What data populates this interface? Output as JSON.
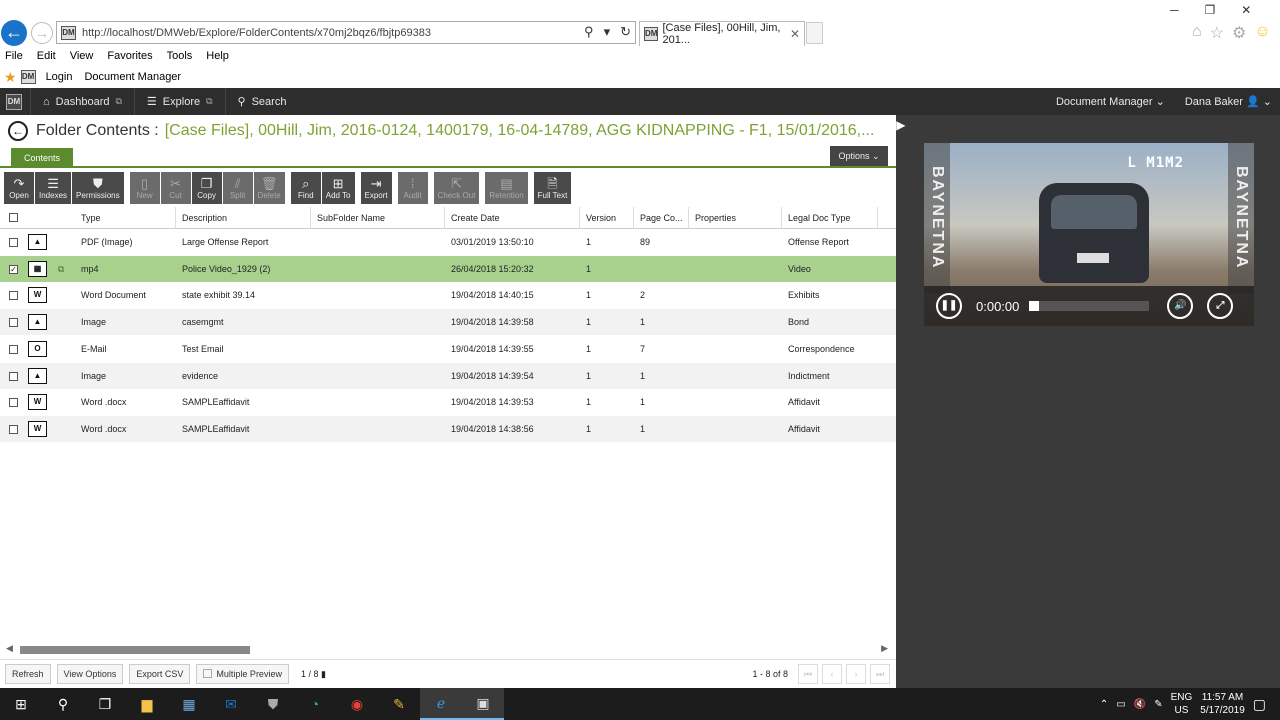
{
  "browser": {
    "url": "http://localhost/DMWeb/Explore/FolderContents/x70mj2bqz6/fbjtp69383",
    "tab_title": "[Case Files], 00Hill, Jim, 201...",
    "favicon_text": "DM",
    "menu": [
      "File",
      "Edit",
      "View",
      "Favorites",
      "Tools",
      "Help"
    ],
    "favorites": {
      "login": "Login",
      "document_manager": "Document Manager"
    }
  },
  "app_nav": {
    "logo": "DM",
    "dashboard": "Dashboard",
    "explore": "Explore",
    "search": "Search",
    "module": "Document Manager",
    "user": "Dana Baker"
  },
  "folder": {
    "label": "Folder Contents :",
    "path": "[Case Files], 00Hill, Jim, 2016-0124, 1400179, 16-04-14789, AGG KIDNAPPING - F1, 15/01/2016,...",
    "tab": "Contents",
    "options": "Options"
  },
  "toolbar": {
    "open": "Open",
    "indexes": "Indexes",
    "permissions": "Permissions",
    "new": "New",
    "cut": "Cut",
    "copy": "Copy",
    "split": "Split",
    "delete": "Delete",
    "find": "Find",
    "add_to": "Add To",
    "export": "Export",
    "audit": "Audit",
    "check_out": "Check Out",
    "retention": "Retention",
    "full_text": "Full Text"
  },
  "columns": [
    "Type",
    "Description",
    "SubFolder Name",
    "Create Date",
    "Version",
    "Page Co...",
    "Properties",
    "Legal Doc Type"
  ],
  "rows": [
    {
      "icon": "image",
      "type": "PDF (Image)",
      "description": "Large Offense Report",
      "subfolder": "",
      "date": "03/01/2019 13:50:10",
      "version": "1",
      "pages": "89",
      "properties": "",
      "legal": "Offense Report",
      "checked": ""
    },
    {
      "icon": "video",
      "type": "mp4",
      "description": "Police Video_1929 (2)",
      "subfolder": "",
      "date": "26/04/2018 15:20:32",
      "version": "1",
      "pages": "",
      "properties": "",
      "legal": "Video",
      "checked": "✓"
    },
    {
      "icon": "word",
      "type": "Word Document",
      "description": "state exhibit 39.14",
      "subfolder": "",
      "date": "19/04/2018 14:40:15",
      "version": "1",
      "pages": "2",
      "properties": "",
      "legal": "Exhibits",
      "checked": ""
    },
    {
      "icon": "image",
      "type": "Image",
      "description": "casemgmt",
      "subfolder": "",
      "date": "19/04/2018 14:39:58",
      "version": "1",
      "pages": "1",
      "properties": "",
      "legal": "Bond",
      "checked": ""
    },
    {
      "icon": "outlook",
      "type": "E-Mail",
      "description": "Test Email",
      "subfolder": "",
      "date": "19/04/2018 14:39:55",
      "version": "1",
      "pages": "7",
      "properties": "",
      "legal": "Correspondence",
      "checked": ""
    },
    {
      "icon": "image",
      "type": "Image",
      "description": "evidence",
      "subfolder": "",
      "date": "19/04/2018 14:39:54",
      "version": "1",
      "pages": "1",
      "properties": "",
      "legal": "Indictment",
      "checked": ""
    },
    {
      "icon": "word",
      "type": "Word .docx",
      "description": "SAMPLEaffidavit",
      "subfolder": "",
      "date": "19/04/2018 14:39:53",
      "version": "1",
      "pages": "1",
      "properties": "",
      "legal": "Affidavit",
      "checked": ""
    },
    {
      "icon": "word",
      "type": "Word .docx",
      "description": "SAMPLEaffidavit",
      "subfolder": "",
      "date": "19/04/2018 14:38:56",
      "version": "1",
      "pages": "1",
      "properties": "",
      "legal": "Affidavit",
      "checked": ""
    }
  ],
  "footer": {
    "refresh": "Refresh",
    "view_options": "View Options",
    "export_csv": "Export CSV",
    "multiple_preview": "Multiple Preview",
    "selection": "1 / 8",
    "range": "1 - 8 of 8"
  },
  "video": {
    "overlay": "L M1M2",
    "side_text": "BAYNETNA",
    "time": "0:00:00",
    "progress": 0
  },
  "taskbar": {
    "language": "ENG",
    "region": "US",
    "time": "11:57 AM",
    "date": "5/17/2019"
  },
  "colors": {
    "accent": "#7fa234",
    "tab_green": "#5b8b2c",
    "selected_row": "#a9d18e"
  }
}
